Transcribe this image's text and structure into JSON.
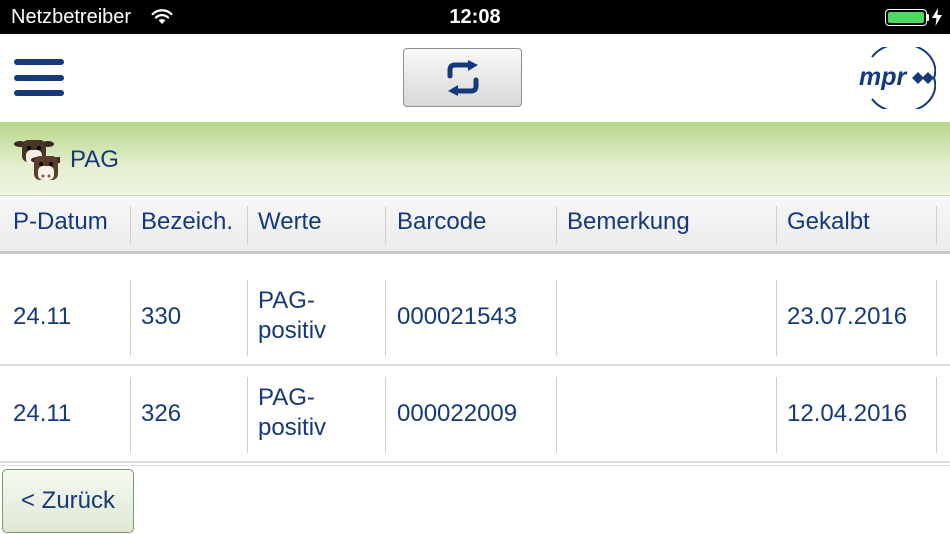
{
  "status_bar": {
    "carrier": "Netzbetreiber",
    "time": "12:08",
    "battery_level": 1.0
  },
  "toolbar": {
    "menu_icon": "hamburger-menu-icon",
    "sync_icon": "sync-arrows-icon",
    "logo_text": "mpr"
  },
  "section": {
    "icon": "cow-heads-icon",
    "title": "PAG"
  },
  "table": {
    "columns": [
      "P-Datum",
      "Bezeich.",
      "Werte",
      "Barcode",
      "Bemerkung",
      "Gekalbt"
    ],
    "rows": [
      {
        "p_datum": "24.11",
        "bezeich": "330",
        "werte_line1": "PAG-",
        "werte_line2": "positiv",
        "barcode": "000021543",
        "bemerkung": "",
        "gekalbt": "23.07.2016"
      },
      {
        "p_datum": "24.11",
        "bezeich": "326",
        "werte_line1": "PAG-",
        "werte_line2": "positiv",
        "barcode": "000022009",
        "bemerkung": "",
        "gekalbt": "12.04.2016"
      }
    ]
  },
  "footer": {
    "back_label": "< Zurück"
  },
  "colors": {
    "text_blue": "#15397a",
    "header_green": "#b7d68b",
    "battery_green": "#4cd964"
  }
}
